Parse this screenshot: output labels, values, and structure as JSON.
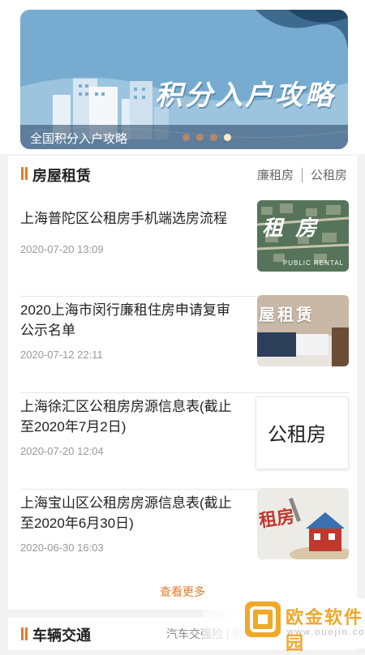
{
  "banner": {
    "title": "积分入户攻略",
    "caption": "全国积分入户攻略"
  },
  "section": {
    "title": "房屋租赁",
    "links": [
      "廉租房",
      "公租房"
    ],
    "items": [
      {
        "title": "上海普陀区公租房手机端选房流程",
        "date": "2020-07-20 13:09",
        "thumb_text": "租 房",
        "thumb_sub": "PUBLIC RENTAL"
      },
      {
        "title": "2020上海市闵行廉租住房申请复审公示名单",
        "date": "2020-07-12 22:11",
        "thumb_text": "屋租赁"
      },
      {
        "title": "上海徐汇区公租房房源信息表(截止至2020年7月2日)",
        "date": "2020-07-20 12:04",
        "thumb_text": "公租房"
      },
      {
        "title": "上海宝山区公租房房源信息表(截止至2020年6月30日)",
        "date": "2020-06-30 16:03",
        "thumb_text": "租房"
      }
    ],
    "more": "查看更多"
  },
  "bottom": {
    "title": "车辆交通",
    "links": "汽车交强险 | 新车上牌 | 车辆年"
  },
  "watermark": {
    "name": "欧金软件园",
    "url": "www.ouojin.com"
  },
  "colors": {
    "accent": "#e8792b",
    "banner": "#7aaed0"
  }
}
